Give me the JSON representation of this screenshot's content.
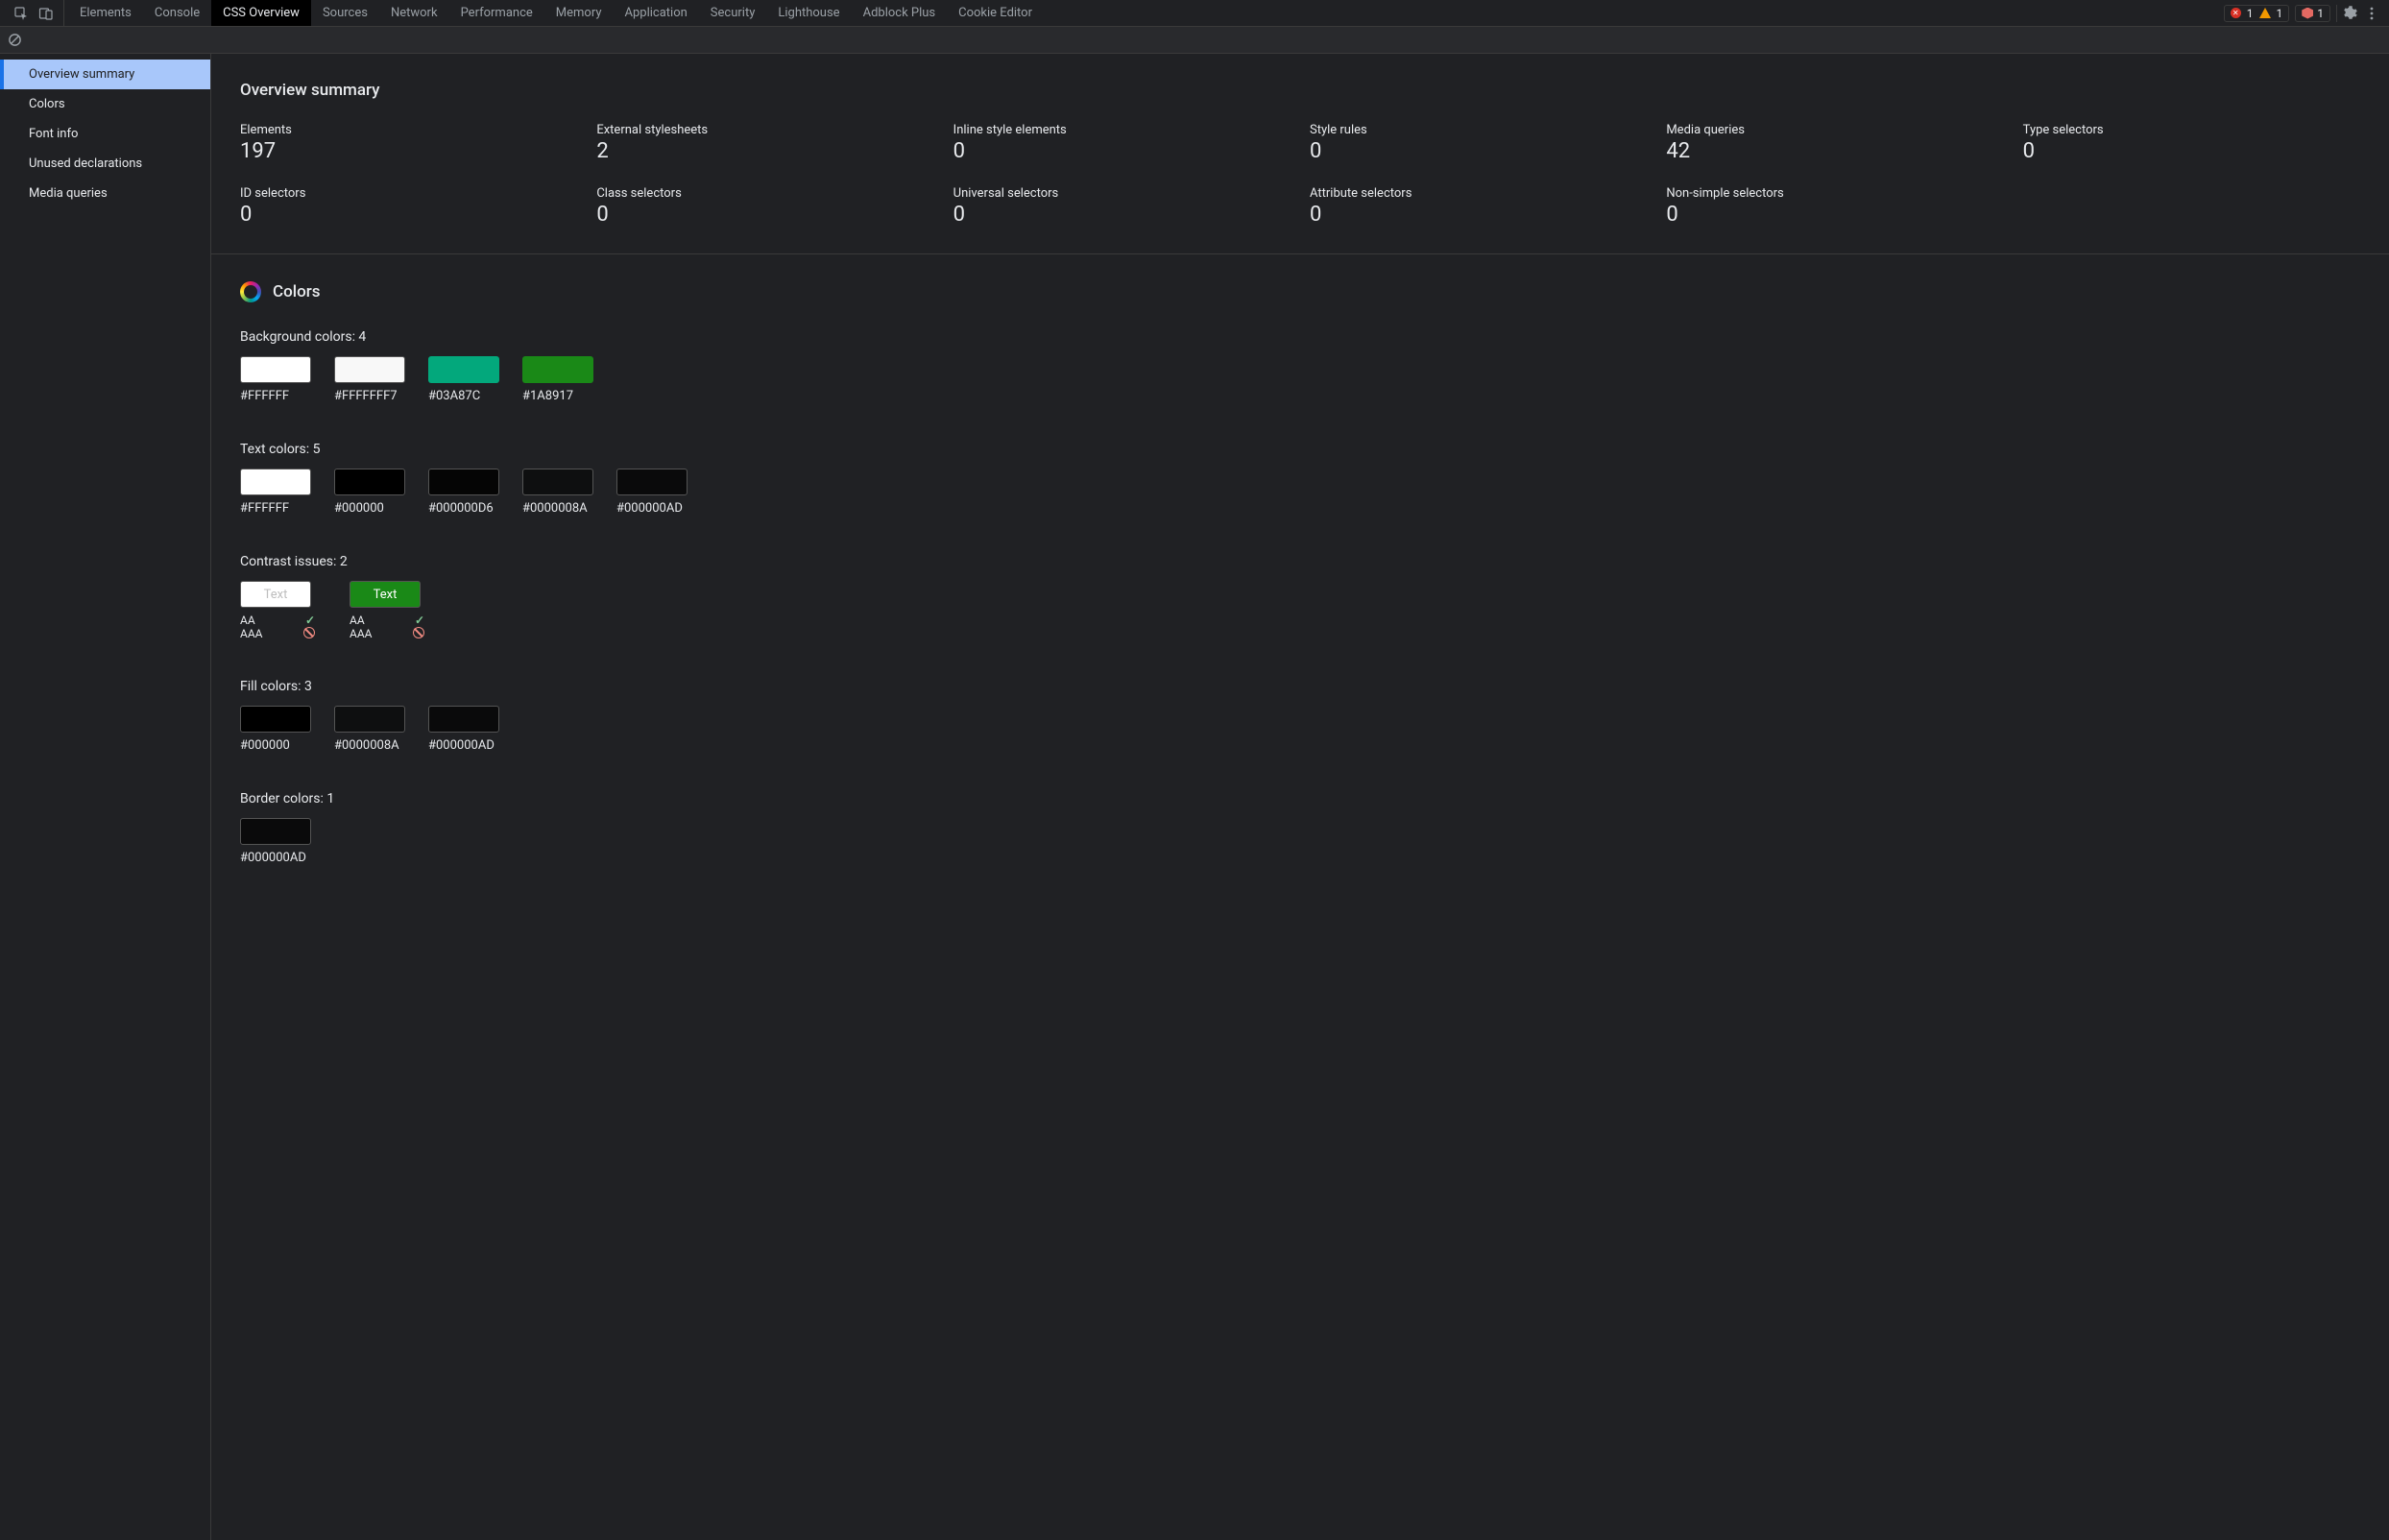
{
  "topbar": {
    "tabs": [
      "Elements",
      "Console",
      "CSS Overview",
      "Sources",
      "Network",
      "Performance",
      "Memory",
      "Application",
      "Security",
      "Lighthouse",
      "Adblock Plus",
      "Cookie Editor"
    ],
    "active_tab_index": 2,
    "errors": "1",
    "warnings": "1",
    "issues": "1"
  },
  "sidebar": {
    "items": [
      "Overview summary",
      "Colors",
      "Font info",
      "Unused declarations",
      "Media queries"
    ],
    "active_index": 0
  },
  "overview": {
    "title": "Overview summary",
    "stats": [
      {
        "label": "Elements",
        "value": "197"
      },
      {
        "label": "External stylesheets",
        "value": "2"
      },
      {
        "label": "Inline style elements",
        "value": "0"
      },
      {
        "label": "Style rules",
        "value": "0"
      },
      {
        "label": "Media queries",
        "value": "42"
      },
      {
        "label": "Type selectors",
        "value": "0"
      },
      {
        "label": "ID selectors",
        "value": "0"
      },
      {
        "label": "Class selectors",
        "value": "0"
      },
      {
        "label": "Universal selectors",
        "value": "0"
      },
      {
        "label": "Attribute selectors",
        "value": "0"
      },
      {
        "label": "Non-simple selectors",
        "value": "0"
      }
    ]
  },
  "colors": {
    "title": "Colors",
    "background": {
      "heading": "Background colors: 4",
      "items": [
        {
          "label": "#FFFFFF",
          "css": "#FFFFFF",
          "bordered": true
        },
        {
          "label": "#FFFFFFF7",
          "css": "rgba(255,255,255,0.97)",
          "bordered": true
        },
        {
          "label": "#03A87C",
          "css": "#03A87C",
          "bordered": false
        },
        {
          "label": "#1A8917",
          "css": "#1A8917",
          "bordered": false
        }
      ]
    },
    "text": {
      "heading": "Text colors: 5",
      "items": [
        {
          "label": "#FFFFFF",
          "css": "#FFFFFF",
          "bordered": true
        },
        {
          "label": "#000000",
          "css": "#000000",
          "bordered": true
        },
        {
          "label": "#000000D6",
          "css": "rgba(0,0,0,0.84)",
          "bordered": true
        },
        {
          "label": "#0000008A",
          "css": "rgba(0,0,0,0.54)",
          "bordered": true
        },
        {
          "label": "#000000AD",
          "css": "rgba(0,0,0,0.68)",
          "bordered": true
        }
      ]
    },
    "contrast": {
      "heading": "Contrast issues: 2",
      "items": [
        {
          "text": "Text",
          "bg": "#FFFFFF",
          "fg": "#bdbdbd",
          "aa_label": "AA",
          "aa_pass": true,
          "aaa_label": "AAA",
          "aaa_pass": false
        },
        {
          "text": "Text",
          "bg": "#1A8917",
          "fg": "#FFFFFF",
          "aa_label": "AA",
          "aa_pass": true,
          "aaa_label": "AAA",
          "aaa_pass": false
        }
      ]
    },
    "fill": {
      "heading": "Fill colors: 3",
      "items": [
        {
          "label": "#000000",
          "css": "#000000",
          "bordered": true
        },
        {
          "label": "#0000008A",
          "css": "rgba(0,0,0,0.54)",
          "bordered": true
        },
        {
          "label": "#000000AD",
          "css": "rgba(0,0,0,0.68)",
          "bordered": true
        }
      ]
    },
    "border": {
      "heading": "Border colors: 1",
      "items": [
        {
          "label": "#000000AD",
          "css": "rgba(0,0,0,0.68)",
          "bordered": true
        }
      ]
    }
  }
}
